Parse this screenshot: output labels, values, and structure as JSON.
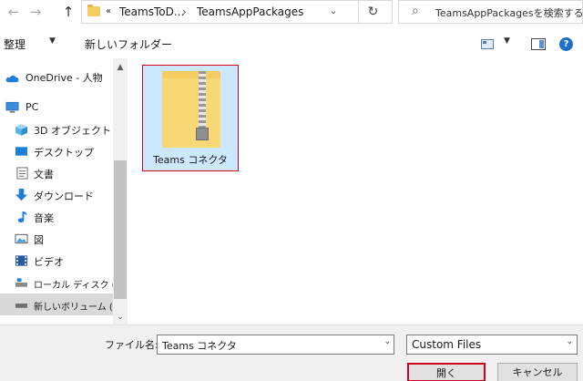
{
  "nav_buttons": {
    "back": "←",
    "forward": "→",
    "up": "↑"
  },
  "address": {
    "overflow": "«",
    "crumbs": [
      "TeamsToD...",
      "TeamsAppPackages"
    ],
    "separator": "›",
    "dropdown": "⌄",
    "refresh": "↻"
  },
  "search": {
    "placeholder": "TeamsAppPackagesを検索する",
    "icon": "⌕"
  },
  "toolbar": {
    "organize": "整理",
    "organize_caret": "▼",
    "new_folder": "新しいフォルダー",
    "view_caret": "▼",
    "help": "?"
  },
  "nav": {
    "items": [
      {
        "label": "OneDrive - 人物",
        "icon": "cloud-icon"
      },
      {
        "label": "PC",
        "icon": "computer-icon"
      },
      {
        "label": "3D オブジェクト",
        "icon": "cube-icon"
      },
      {
        "label": "デスクトップ",
        "icon": "desktop-icon"
      },
      {
        "label": "文書",
        "icon": "document-icon"
      },
      {
        "label": "ダウンロード",
        "icon": "download-arrow-icon"
      },
      {
        "label": "音楽",
        "icon": "music-note-icon"
      },
      {
        "label": "図",
        "icon": "picture-icon"
      },
      {
        "label": "ビデオ",
        "icon": "film-icon"
      },
      {
        "label": "ローカル ディスク (C:)",
        "icon": "drive-icon"
      },
      {
        "label": "新しいボリューム (D:)",
        "icon": "drive-icon"
      }
    ],
    "scroll_up": "▲",
    "scroll_down": "⌄"
  },
  "files": [
    {
      "name": "Teams コネクタ",
      "icon": "zip-folder-icon"
    }
  ],
  "bottom": {
    "filename_label": "ファイル名:",
    "filename_value": "Teams コネクタ",
    "filename_chev": "⌄",
    "filetype_value": "Custom Files",
    "filetype_chev": "⌄",
    "open": "開く",
    "cancel": "キャンセル"
  },
  "colors": {
    "selection": "#cce8ff",
    "highlight_border": "#d0021b",
    "folder": "#f8d775",
    "accent": "#1f6fc8"
  }
}
